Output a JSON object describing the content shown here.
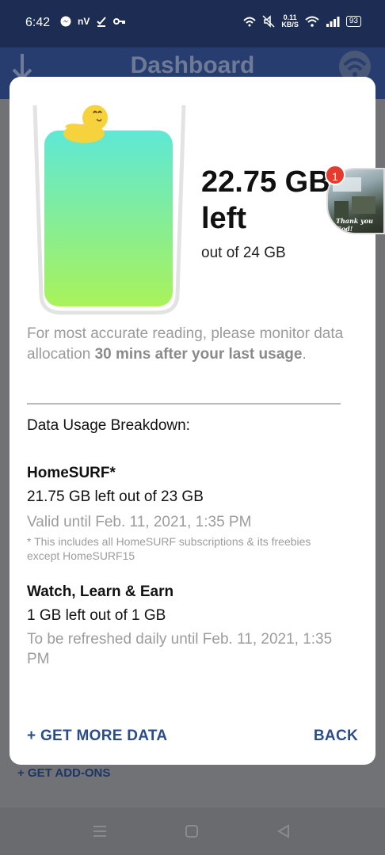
{
  "status_bar": {
    "time": "6:42",
    "carrier_label": "nV",
    "net_speed_value": "0.11",
    "net_speed_unit": "KB/S",
    "battery": "93"
  },
  "app_bar": {
    "title": "Dashboard"
  },
  "background": {
    "get_addons_label": "+ GET ADD-ONS"
  },
  "dialog": {
    "remaining_amount": "22.75 GB",
    "remaining_suffix": "left",
    "total_text": "out of 24 GB",
    "fill_fraction": 0.95,
    "note_prefix": "For most accurate reading, please monitor data allocation ",
    "note_bold": "30 mins after your last usage",
    "note_suffix": ".",
    "breakdown_title": "Data Usage Breakdown:",
    "sections": [
      {
        "title": "HomeSURF*",
        "usage": "21.75 GB left out of 23 GB",
        "validity": "Valid until Feb. 11, 2021, 1:35 PM",
        "footnote": "* This includes all HomeSURF subscriptions & its freebies except HomeSURF15"
      },
      {
        "title": "Watch, Learn & Earn",
        "usage": "1 GB left out of 1 GB",
        "validity": "To be refreshed daily until Feb. 11, 2021, 1:35 PM"
      }
    ],
    "get_more_label": "+ GET MORE DATA",
    "back_label": "BACK"
  },
  "chat_head": {
    "badge_count": "1",
    "caption": "Thank you God!"
  },
  "colors": {
    "status_bar": "#1c2c52",
    "app_bar": "#273d6f",
    "accent_button": "#2b4c8c",
    "water_top": "#5ee8d6",
    "water_bottom": "#a9f25a",
    "duck": "#f6d23c",
    "badge": "#e53b2f"
  }
}
